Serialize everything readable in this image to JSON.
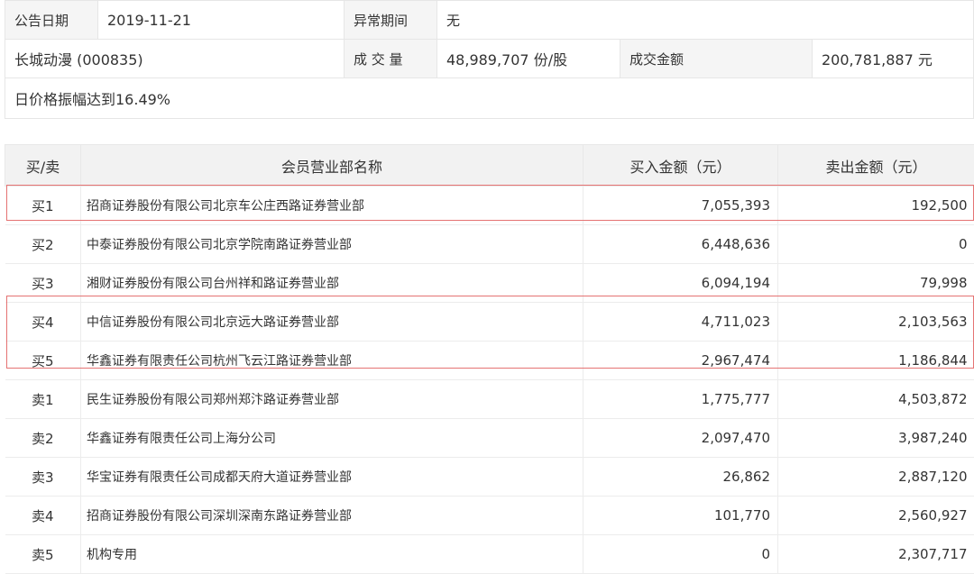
{
  "announcement": {
    "date_label": "公告日期",
    "date_value": "2019-11-21",
    "abnormal_period_label": "异常期间",
    "abnormal_period_value": "无",
    "stock_name": "长城动漫 (000835)",
    "volume_label": "成 交 量",
    "volume_value": "48,989,707 份/股",
    "turnover_label": "成交金额",
    "turnover_value": "200,781,887 元",
    "reason": "日价格振幅达到16.49%"
  },
  "table": {
    "headers": [
      "买/卖",
      "会员营业部名称",
      "买入金额（元）",
      "卖出金额（元）"
    ],
    "rows": [
      {
        "side": "买1",
        "name": "招商证券股份有限公司北京车公庄西路证券营业部",
        "buy": "7,055,393",
        "sell": "192,500"
      },
      {
        "side": "买2",
        "name": "中泰证券股份有限公司北京学院南路证券营业部",
        "buy": "6,448,636",
        "sell": "0"
      },
      {
        "side": "买3",
        "name": "湘财证券股份有限公司台州祥和路证券营业部",
        "buy": "6,094,194",
        "sell": "79,998"
      },
      {
        "side": "买4",
        "name": "中信证券股份有限公司北京远大路证券营业部",
        "buy": "4,711,023",
        "sell": "2,103,563"
      },
      {
        "side": "买5",
        "name": "华鑫证券有限责任公司杭州飞云江路证券营业部",
        "buy": "2,967,474",
        "sell": "1,186,844"
      },
      {
        "side": "卖1",
        "name": "民生证券股份有限公司郑州郑汴路证券营业部",
        "buy": "1,775,777",
        "sell": "4,503,872"
      },
      {
        "side": "卖2",
        "name": "华鑫证券有限责任公司上海分公司",
        "buy": "2,097,470",
        "sell": "3,987,240"
      },
      {
        "side": "卖3",
        "name": "华宝证券有限责任公司成都天府大道证券营业部",
        "buy": "26,862",
        "sell": "2,887,120"
      },
      {
        "side": "卖4",
        "name": "招商证券股份有限公司深圳深南东路证券营业部",
        "buy": "101,770",
        "sell": "2,560,927"
      },
      {
        "side": "卖5",
        "name": "机构专用",
        "buy": "0",
        "sell": "2,307,717"
      }
    ]
  },
  "highlight_color": "#e57373"
}
